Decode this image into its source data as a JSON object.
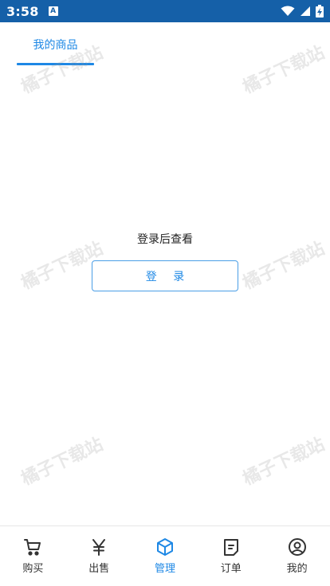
{
  "status_bar": {
    "time": "3:58",
    "badge": "A"
  },
  "tabs": {
    "active_label": "我的商品"
  },
  "main": {
    "empty_message": "登录后查看",
    "login_button": "登 录"
  },
  "watermark": {
    "text": "橘子下载站"
  },
  "bottom_nav": {
    "items": [
      {
        "label": "购买",
        "icon": "cart-icon",
        "active": false
      },
      {
        "label": "出售",
        "icon": "yen-icon",
        "active": false
      },
      {
        "label": "管理",
        "icon": "box-icon",
        "active": true
      },
      {
        "label": "订单",
        "icon": "order-icon",
        "active": false
      },
      {
        "label": "我的",
        "icon": "profile-icon",
        "active": false
      }
    ]
  },
  "colors": {
    "status_bar": "#1560a8",
    "accent": "#1e88e5"
  }
}
